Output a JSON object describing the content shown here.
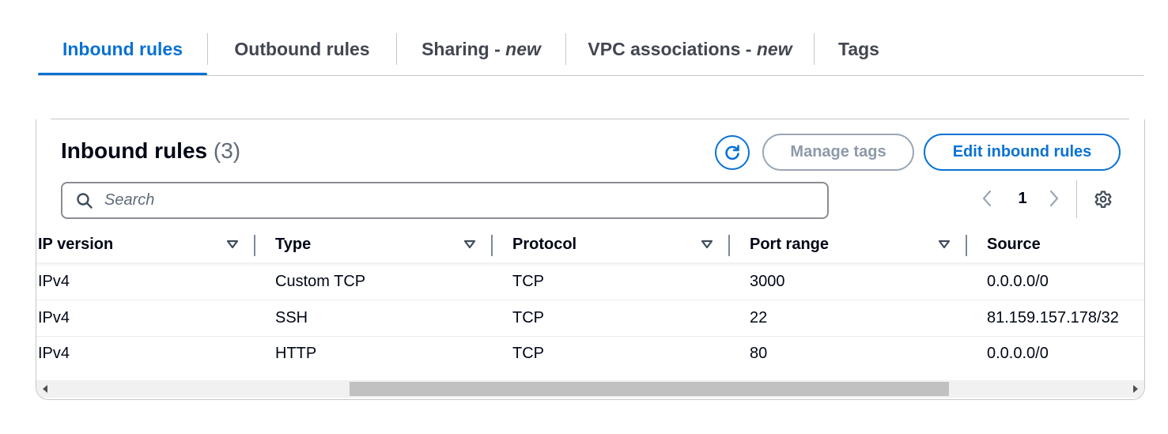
{
  "tabs": [
    {
      "label": "Inbound rules",
      "suffix": ""
    },
    {
      "label": "Outbound rules",
      "suffix": ""
    },
    {
      "label": "Sharing - ",
      "suffix": "new"
    },
    {
      "label": "VPC associations - ",
      "suffix": "new"
    },
    {
      "label": "Tags",
      "suffix": ""
    }
  ],
  "active_tab": "Inbound rules",
  "panel": {
    "title": "Inbound rules",
    "count": "(3)",
    "manage_tags_label": "Manage tags",
    "edit_label": "Edit inbound rules",
    "refresh_icon": "refresh-icon"
  },
  "search": {
    "placeholder": "Search",
    "value": ""
  },
  "pagination": {
    "current_page": "1"
  },
  "table": {
    "columns": [
      "IP version",
      "Type",
      "Protocol",
      "Port range",
      "Source"
    ],
    "rows": [
      [
        "IPv4",
        "Custom TCP",
        "TCP",
        "3000",
        "0.0.0.0/0"
      ],
      [
        "IPv4",
        "SSH",
        "TCP",
        "22",
        "81.159.157.178/32"
      ],
      [
        "IPv4",
        "HTTP",
        "TCP",
        "80",
        "0.0.0.0/0"
      ]
    ]
  },
  "colors": {
    "accent": "#0972d3",
    "disabled": "#8d99a8",
    "text": "#000716"
  }
}
